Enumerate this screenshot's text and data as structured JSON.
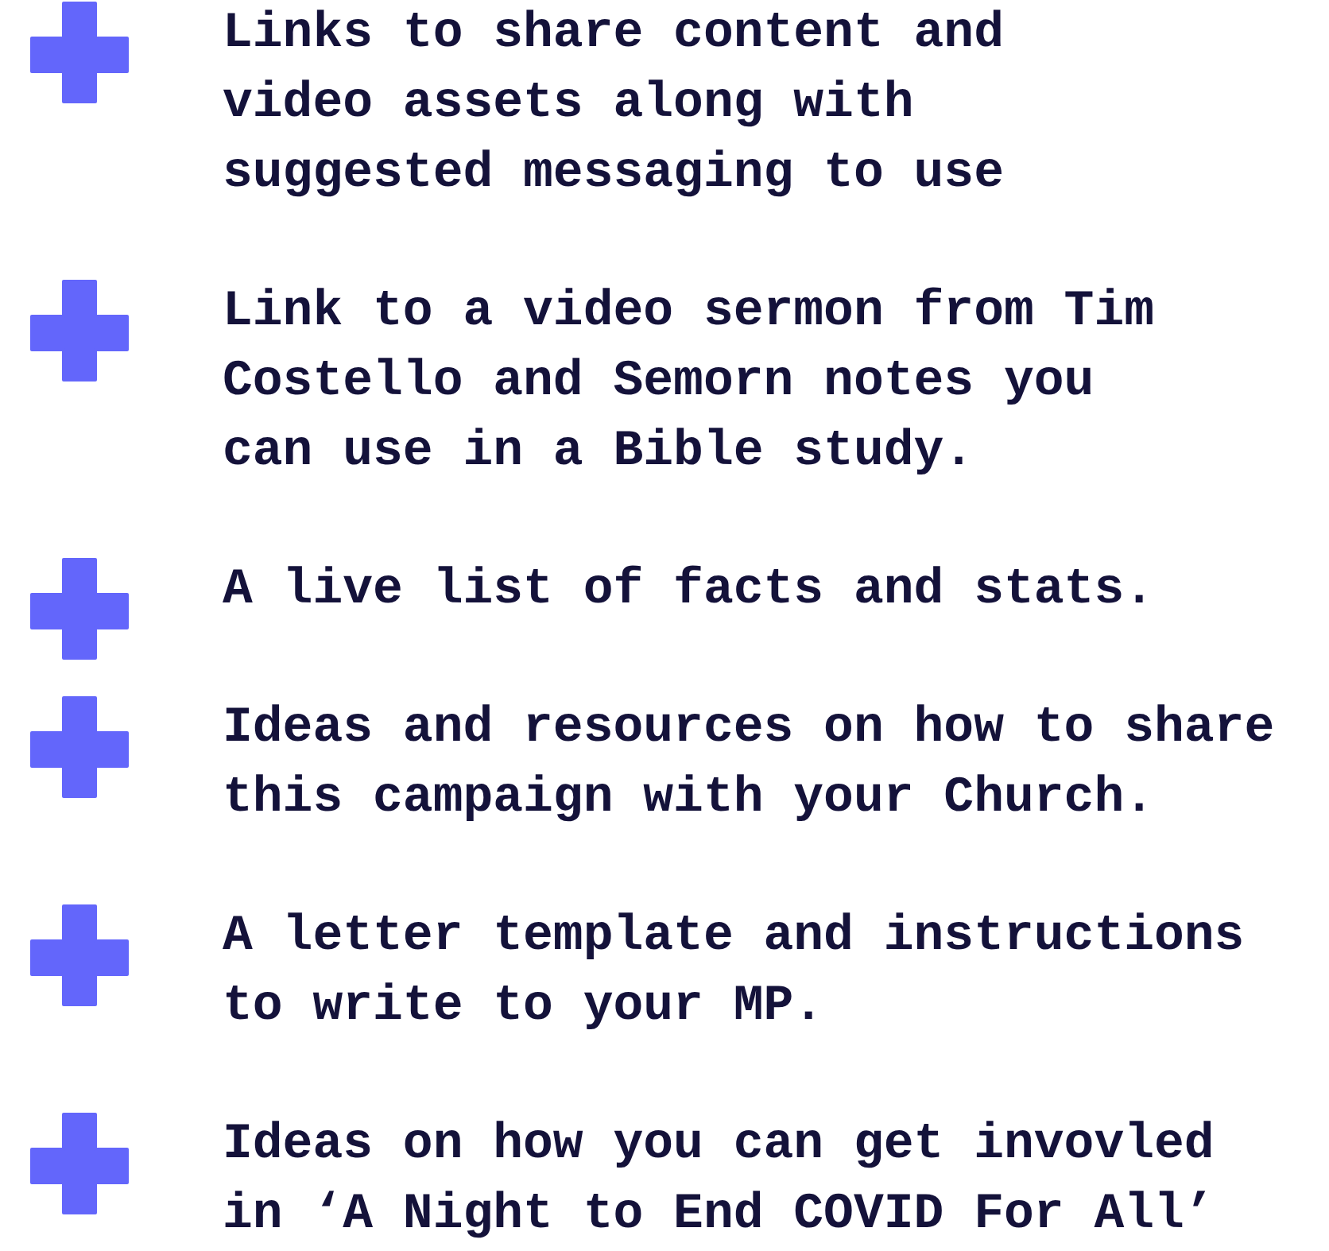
{
  "items": [
    {
      "lines": [
        "Links to share content and",
        "video assets along with",
        "suggested messaging to use"
      ]
    },
    {
      "lines": [
        "Link to a video sermon from Tim",
        "Costello and Semorn notes you",
        "can use in a Bible study."
      ]
    },
    {
      "lines": [
        "A live list of facts and stats."
      ]
    },
    {
      "lines": [
        "Ideas and resources on how to share",
        "this campaign with your Church."
      ]
    },
    {
      "lines": [
        "A letter template and instructions",
        "to write to your MP."
      ]
    },
    {
      "lines": [
        "Ideas on how you can get invovled",
        "in ‘A Night to End COVID For All’"
      ]
    }
  ]
}
